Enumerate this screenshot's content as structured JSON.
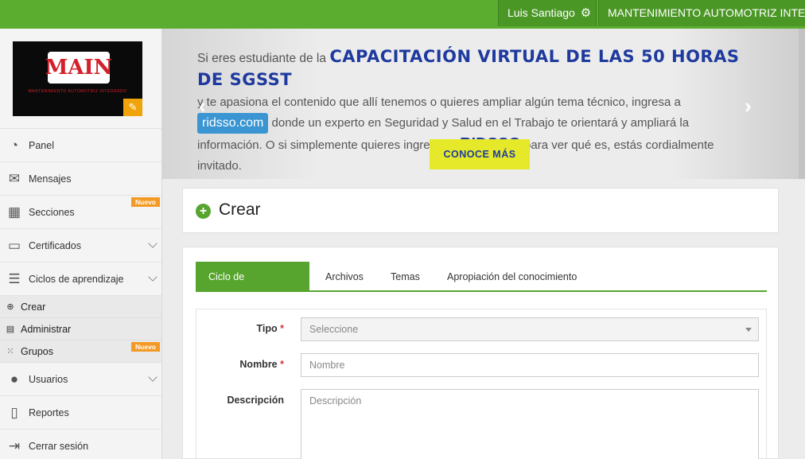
{
  "topbar": {
    "user_name": "Luis Santiago",
    "company": "MANTENIMIENTO AUTOMOTRIZ INTEGRADO"
  },
  "logo": {
    "brand": "MAIN",
    "tagline": "MANTENIMIENTO AUTOMOTRIZ INTEGRADO"
  },
  "sidebar": {
    "items": [
      {
        "label": "Panel",
        "icon": "dashboard-icon"
      },
      {
        "label": "Mensajes",
        "icon": "envelope-icon"
      },
      {
        "label": "Secciones",
        "icon": "grid-icon",
        "badge": "Nuevo"
      },
      {
        "label": "Certificados",
        "icon": "card-icon"
      },
      {
        "label": "Ciclos de aprendizaje",
        "icon": "server-icon"
      }
    ],
    "subitems": [
      {
        "label": "Crear",
        "icon": "plus-circle-icon"
      },
      {
        "label": "Administrar",
        "icon": "list-icon"
      },
      {
        "label": "Grupos",
        "icon": "grid-small-icon",
        "badge": "Nuevo"
      }
    ],
    "bottom_items": [
      {
        "label": "Usuarios",
        "icon": "user-icon"
      },
      {
        "label": "Reportes",
        "icon": "document-icon"
      },
      {
        "label": "Cerrar sesión",
        "icon": "sign-out-icon"
      }
    ]
  },
  "banner": {
    "line1_pre": "Si eres estudiante de la",
    "line1_highlight": "CAPACITACIÓN VIRTUAL DE LAS 50 HORAS DE SGSST",
    "line2": "y te apasiona el contenido que allí tenemos o quieres ampliar algún tema técnico, ingresa a",
    "link": "ridsso.com",
    "line3": "donde un experto en Seguridad y Salud en el Trabajo te orientará y ampliará la",
    "line4_pre": "información. O si simplemente quieres ingresar a",
    "line4_brand": "RIDSSO",
    "line4_post": "para ver qué es, estás cordialmente",
    "line5": "invitado.",
    "cta": "CONOCE MÁS"
  },
  "page": {
    "title": "Crear"
  },
  "tabs": [
    {
      "label": "Ciclo de aprendizaje",
      "active": true
    },
    {
      "label": "Archivos",
      "active": false
    },
    {
      "label": "Temas",
      "active": false
    },
    {
      "label": "Apropiación del conocimiento",
      "active": false
    }
  ],
  "form": {
    "tipo_label": "Tipo",
    "tipo_value": "Seleccione",
    "nombre_label": "Nombre",
    "nombre_placeholder": "Nombre",
    "descripcion_label": "Descripción",
    "descripcion_placeholder": "Descripción",
    "required_mark": "*"
  },
  "colors": {
    "accent": "#57a52f",
    "badge": "#f39a26",
    "banner_highlight": "#1e3a9e",
    "cta": "#e5e92a"
  }
}
